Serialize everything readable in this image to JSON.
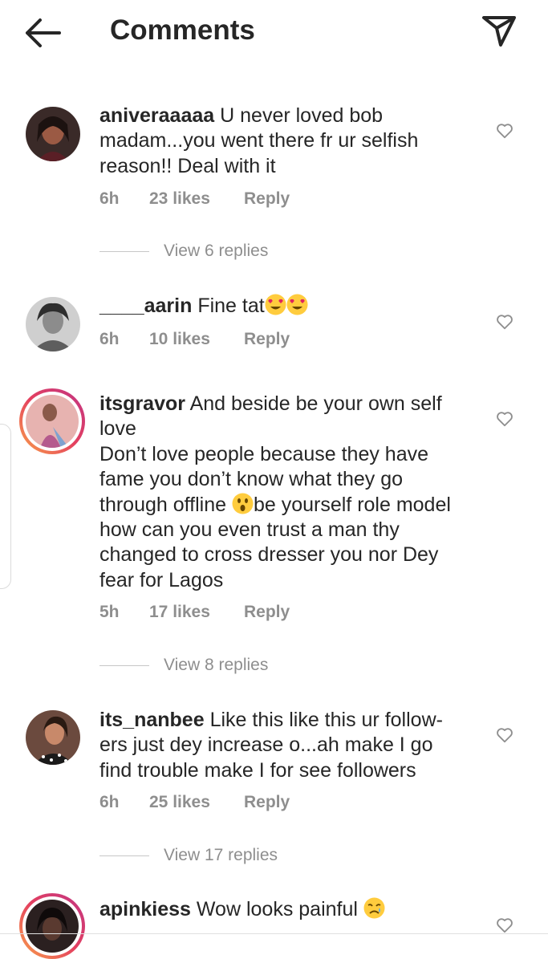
{
  "header": {
    "title": "Comments"
  },
  "comments": [
    {
      "username": "aniveraaaaa",
      "text": "U never loved bob madam...you went there fr ur selfish reason!! Deal with it",
      "time": "6h",
      "likes": "23 likes",
      "reply": "Reply",
      "view_replies": "View 6 replies"
    },
    {
      "username": "____aarin",
      "text": "Fine tat",
      "emoji": [
        "heart-eyes",
        "heart-eyes"
      ],
      "time": "6h",
      "likes": "10 likes",
      "reply": "Reply"
    },
    {
      "username": "itsgravor",
      "text_line1": "And beside be your own self love",
      "text_line2": "Don’t love people because they have fame you don’t know what they go through offline",
      "text_line3": "be yourself role model how can you even trust a man thy changed to cross dresser you nor Dey fear for Lagos",
      "emoji": [
        "surprised"
      ],
      "time": "5h",
      "likes": "17 likes",
      "reply": "Reply",
      "view_replies": "View 8 replies"
    },
    {
      "username": "its_nanbee",
      "text": "Like this like this ur follow-ers just dey increase o...ah make I go find trouble make I for see followers",
      "time": "6h",
      "likes": "25 likes",
      "reply": "Reply",
      "view_replies": "View 17 replies"
    },
    {
      "username": "apinkiess",
      "text": "Wow looks painful",
      "emoji": [
        "crying"
      ]
    }
  ],
  "colors": {
    "text": "#262626",
    "meta": "#8e8e8e",
    "story_ring": "#e4405f"
  }
}
